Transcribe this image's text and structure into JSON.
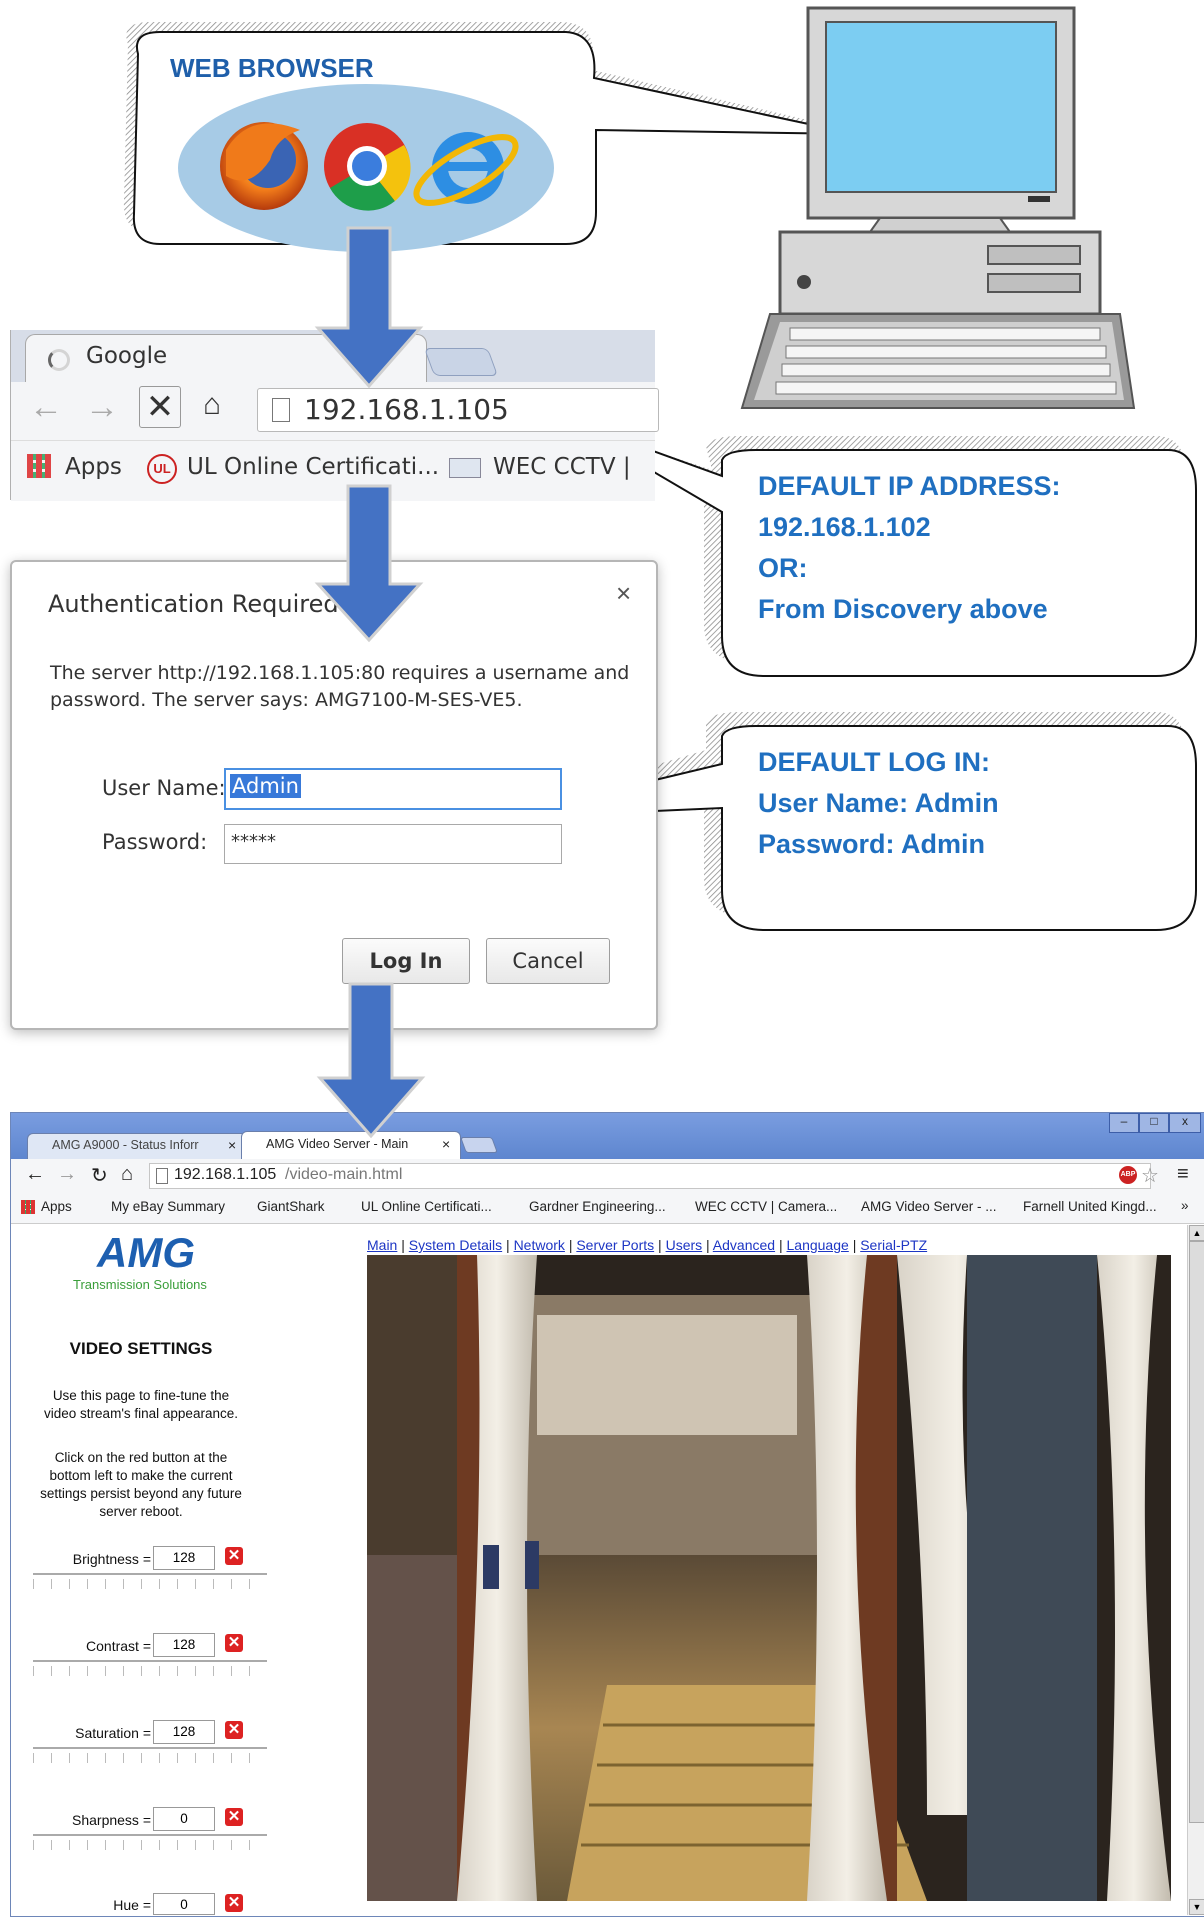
{
  "web_browser_bubble": {
    "title": "WEB BROWSER"
  },
  "browser_icons": [
    "firefox-icon",
    "chrome-icon",
    "internet-explorer-icon"
  ],
  "top_browser": {
    "tab_title": "Google",
    "address": "192.168.1.105",
    "bookmarks": [
      "Apps",
      "UL Online Certificati...",
      "WEC CCTV |"
    ]
  },
  "ip_callout": {
    "lines": [
      "DEFAULT IP ADDRESS:",
      "192.168.1.102",
      "OR:",
      "From Discovery above"
    ]
  },
  "login_callout": {
    "lines": [
      "DEFAULT LOG IN:",
      "User Name: Admin",
      "Password: Admin"
    ]
  },
  "auth_dialog": {
    "title": "Authentication Required",
    "message_line1": "The server http://192.168.1.105:80 requires a username and",
    "message_line2": "password. The server says: AMG7100-M-SES-VE5.",
    "username_label": "User Name:",
    "username_value": "Admin",
    "password_label": "Password:",
    "password_value": "*****",
    "login_button": "Log In",
    "cancel_button": "Cancel",
    "close_symbol": "×"
  },
  "bottom_browser": {
    "tabs": [
      {
        "label": "AMG A9000 - Status Inforr",
        "close": "×"
      },
      {
        "label": "AMG Video Server - Main",
        "close": "×"
      }
    ],
    "window_controls": [
      "–",
      "□",
      "x"
    ],
    "address_host": "192.168.1.105",
    "address_path": "/video-main.html",
    "adblock_badge": "ABP",
    "bookmarks": [
      "Apps",
      "My eBay Summary",
      "GiantShark",
      "UL Online Certificati...",
      "Gardner Engineering...",
      "WEC CCTV | Camera...",
      "AMG Video Server - ...",
      "Farnell United Kingd..."
    ],
    "more_bookmarks": "»"
  },
  "amg_page": {
    "logo_text": "AMG",
    "logo_subtitle": "Transmission Solutions",
    "heading": "VIDEO SETTINGS",
    "intro_line1": "Use this page to fine-tune the",
    "intro_line2": "video stream's final appearance.",
    "persist_line1": "Click on the red button at the",
    "persist_line2": "bottom left to make the current",
    "persist_line3": "settings persist beyond any future",
    "persist_line4": "server reboot.",
    "settings": [
      {
        "label": "Brightness =",
        "value": "128"
      },
      {
        "label": "Contrast =",
        "value": "128"
      },
      {
        "label": "Saturation =",
        "value": "128"
      },
      {
        "label": "Sharpness =",
        "value": "0"
      },
      {
        "label": "Hue =",
        "value": "0"
      }
    ],
    "nav_links": [
      "Main",
      "System Details",
      "Network",
      "Server Ports",
      "Users",
      "Advanced",
      "Language",
      "Serial-PTZ"
    ],
    "nav_separator": "|"
  },
  "colors": {
    "callout_text": "#1f6fc0",
    "arrow_fill": "#4472c4",
    "bubble_fill": "#a7cbe6",
    "link": "#1d36c4",
    "reset_button": "#dd2222"
  }
}
